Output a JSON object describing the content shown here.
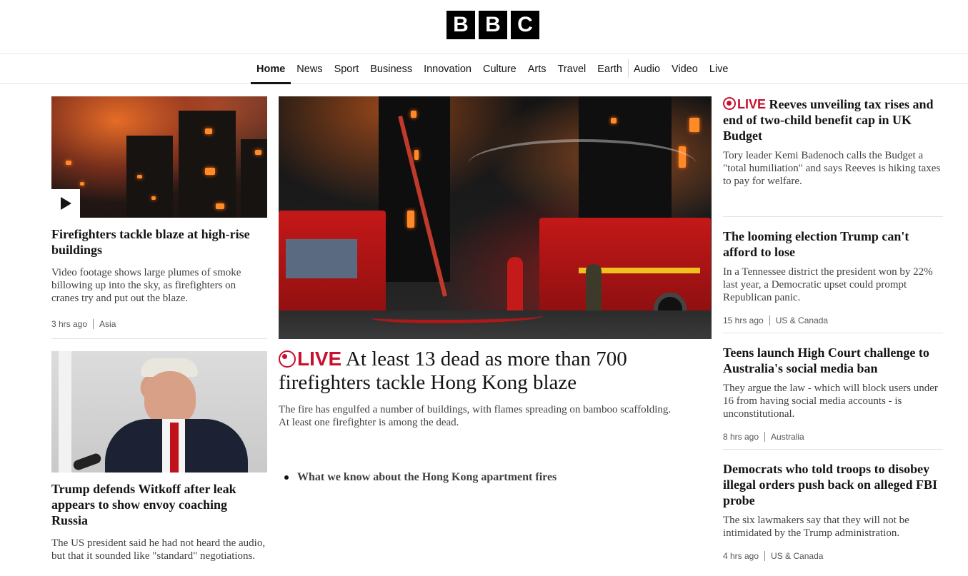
{
  "brand": {
    "letters": [
      "B",
      "B",
      "C"
    ]
  },
  "nav": {
    "items": [
      {
        "label": "Home",
        "active": true
      },
      {
        "label": "News"
      },
      {
        "label": "Sport"
      },
      {
        "label": "Business"
      },
      {
        "label": "Innovation"
      },
      {
        "label": "Culture"
      },
      {
        "label": "Arts"
      },
      {
        "label": "Travel"
      },
      {
        "label": "Earth"
      },
      {
        "label": "Audio"
      },
      {
        "label": "Video"
      },
      {
        "label": "Live"
      }
    ]
  },
  "left": {
    "story1": {
      "headline": "Firefighters tackle blaze at high-rise buildings",
      "summary": "Video footage shows large plumes of smoke billowing up into the sky, as firefighters on cranes try and put out the blaze.",
      "time": "3 hrs ago",
      "section": "Asia",
      "image_icon": "play-icon"
    },
    "story2": {
      "headline": "Trump defends Witkoff after leak appears to show envoy coaching Russia",
      "summary": "The US president said he had not heard the audio, but that it sounded like \"standard\" negotiations."
    }
  },
  "main": {
    "live_label": "LIVE",
    "headline": "At least 13 dead as more than 700 firefighters tackle Hong Kong blaze",
    "summary": "The fire has engulfed a number of buildings, with flames spreading on bamboo scaffolding. At least one firefighter is among the dead.",
    "related": [
      "What we know about the Hong Kong apartment fires"
    ]
  },
  "right": {
    "story1": {
      "live_label": "LIVE",
      "headline": "Reeves unveiling tax rises and end of two-child benefit cap in UK Budget",
      "summary": "Tory leader Kemi Badenoch calls the Budget a \"total humiliation\" and says Reeves is hiking taxes to pay for welfare."
    },
    "story2": {
      "headline": "The looming election Trump can't afford to lose",
      "summary": "In a Tennessee district the president won by 22% last year, a Democratic upset could prompt Republican panic.",
      "time": "15 hrs ago",
      "section": "US & Canada"
    },
    "story3": {
      "headline": "Teens launch High Court challenge to Australia's social media ban",
      "summary": "They argue the law - which will block users under 16 from having social media accounts - is unconstitutional.",
      "time": "8 hrs ago",
      "section": "Australia"
    },
    "story4": {
      "headline": "Democrats who told troops to disobey illegal orders push back on alleged FBI probe",
      "summary": "The six lawmakers say that they will not be intimidated by the Trump administration.",
      "time": "4 hrs ago",
      "section": "US & Canada"
    }
  },
  "colors": {
    "live_red": "#c8102e",
    "text": "#141414",
    "summary": "#3f3f42"
  }
}
